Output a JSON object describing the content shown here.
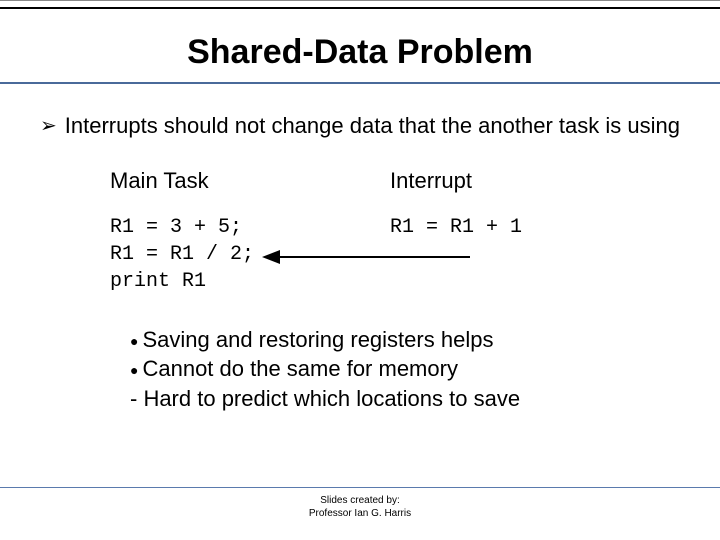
{
  "title": "Shared-Data Problem",
  "main_bullet": "Interrupts should not change data that the another task is using",
  "columns": {
    "left": {
      "heading": "Main Task",
      "code": "R1 = 3 + 5;\nR1 = R1 / 2;\nprint R1"
    },
    "right": {
      "heading": "Interrupt",
      "code": "R1 = R1 + 1"
    }
  },
  "sub_bullets": {
    "item1": "Saving and restoring registers helps",
    "item2": "Cannot do the same for memory",
    "dash1": "- Hard to predict which locations to save"
  },
  "footer": {
    "line1": "Slides created by:",
    "line2": "Professor Ian G. Harris"
  }
}
